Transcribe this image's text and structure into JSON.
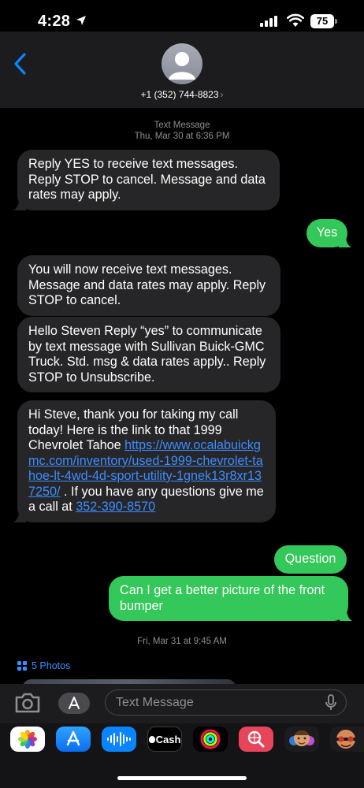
{
  "status_bar": {
    "time": "4:28",
    "battery": "75"
  },
  "header": {
    "contact": "+1 (352) 744-8823",
    "chevron": "›"
  },
  "conversation": {
    "date1_label": "Text Message",
    "date1": "Thu, Mar 30 at 6:36 PM",
    "msg1": "Reply YES to receive text messages. Reply STOP to cancel. Message and data rates may apply.",
    "msg2": "Yes",
    "msg3": "You will now receive text messages. Message and data rates may apply. Reply STOP to cancel.",
    "msg4": "Hello Steven Reply “yes” to communicate by text message with Sullivan Buick-GMC Truck. Std. msg & data rates apply.. Reply STOP to Unsubscribe.",
    "msg5": {
      "text_before": "Hi Steve, thank you for taking my call today! Here is the link to that 1999 Chevrolet Tahoe ",
      "link1": "https://www.ocalabuickgmc.com/inventory/used-1999-chevrolet-tahoe-lt-4wd-4d-sport-utility-1gnek13r8xr137250/",
      "text_middle": " . If you have any questions give me a call at ",
      "link2": "352-390-8570"
    },
    "msg6": "Question",
    "msg7": "Can I get a better picture of the front bumper",
    "date2": "Fri, Mar 31 at 9:45 AM",
    "photos_label": "5 Photos"
  },
  "input": {
    "placeholder": "Text Message"
  },
  "apps": {
    "items": [
      "photos-app",
      "app-store-app",
      "audio-message-app",
      "apple-cash-app",
      "fitness-app",
      "image-search-app",
      "memoji-app",
      "memoji-stickers-app"
    ],
    "cash_label": "Cash"
  },
  "colors": {
    "incoming": "#262628",
    "outgoing": "#34c759",
    "link": "#3c8cff",
    "header": "#1c1c1e"
  }
}
